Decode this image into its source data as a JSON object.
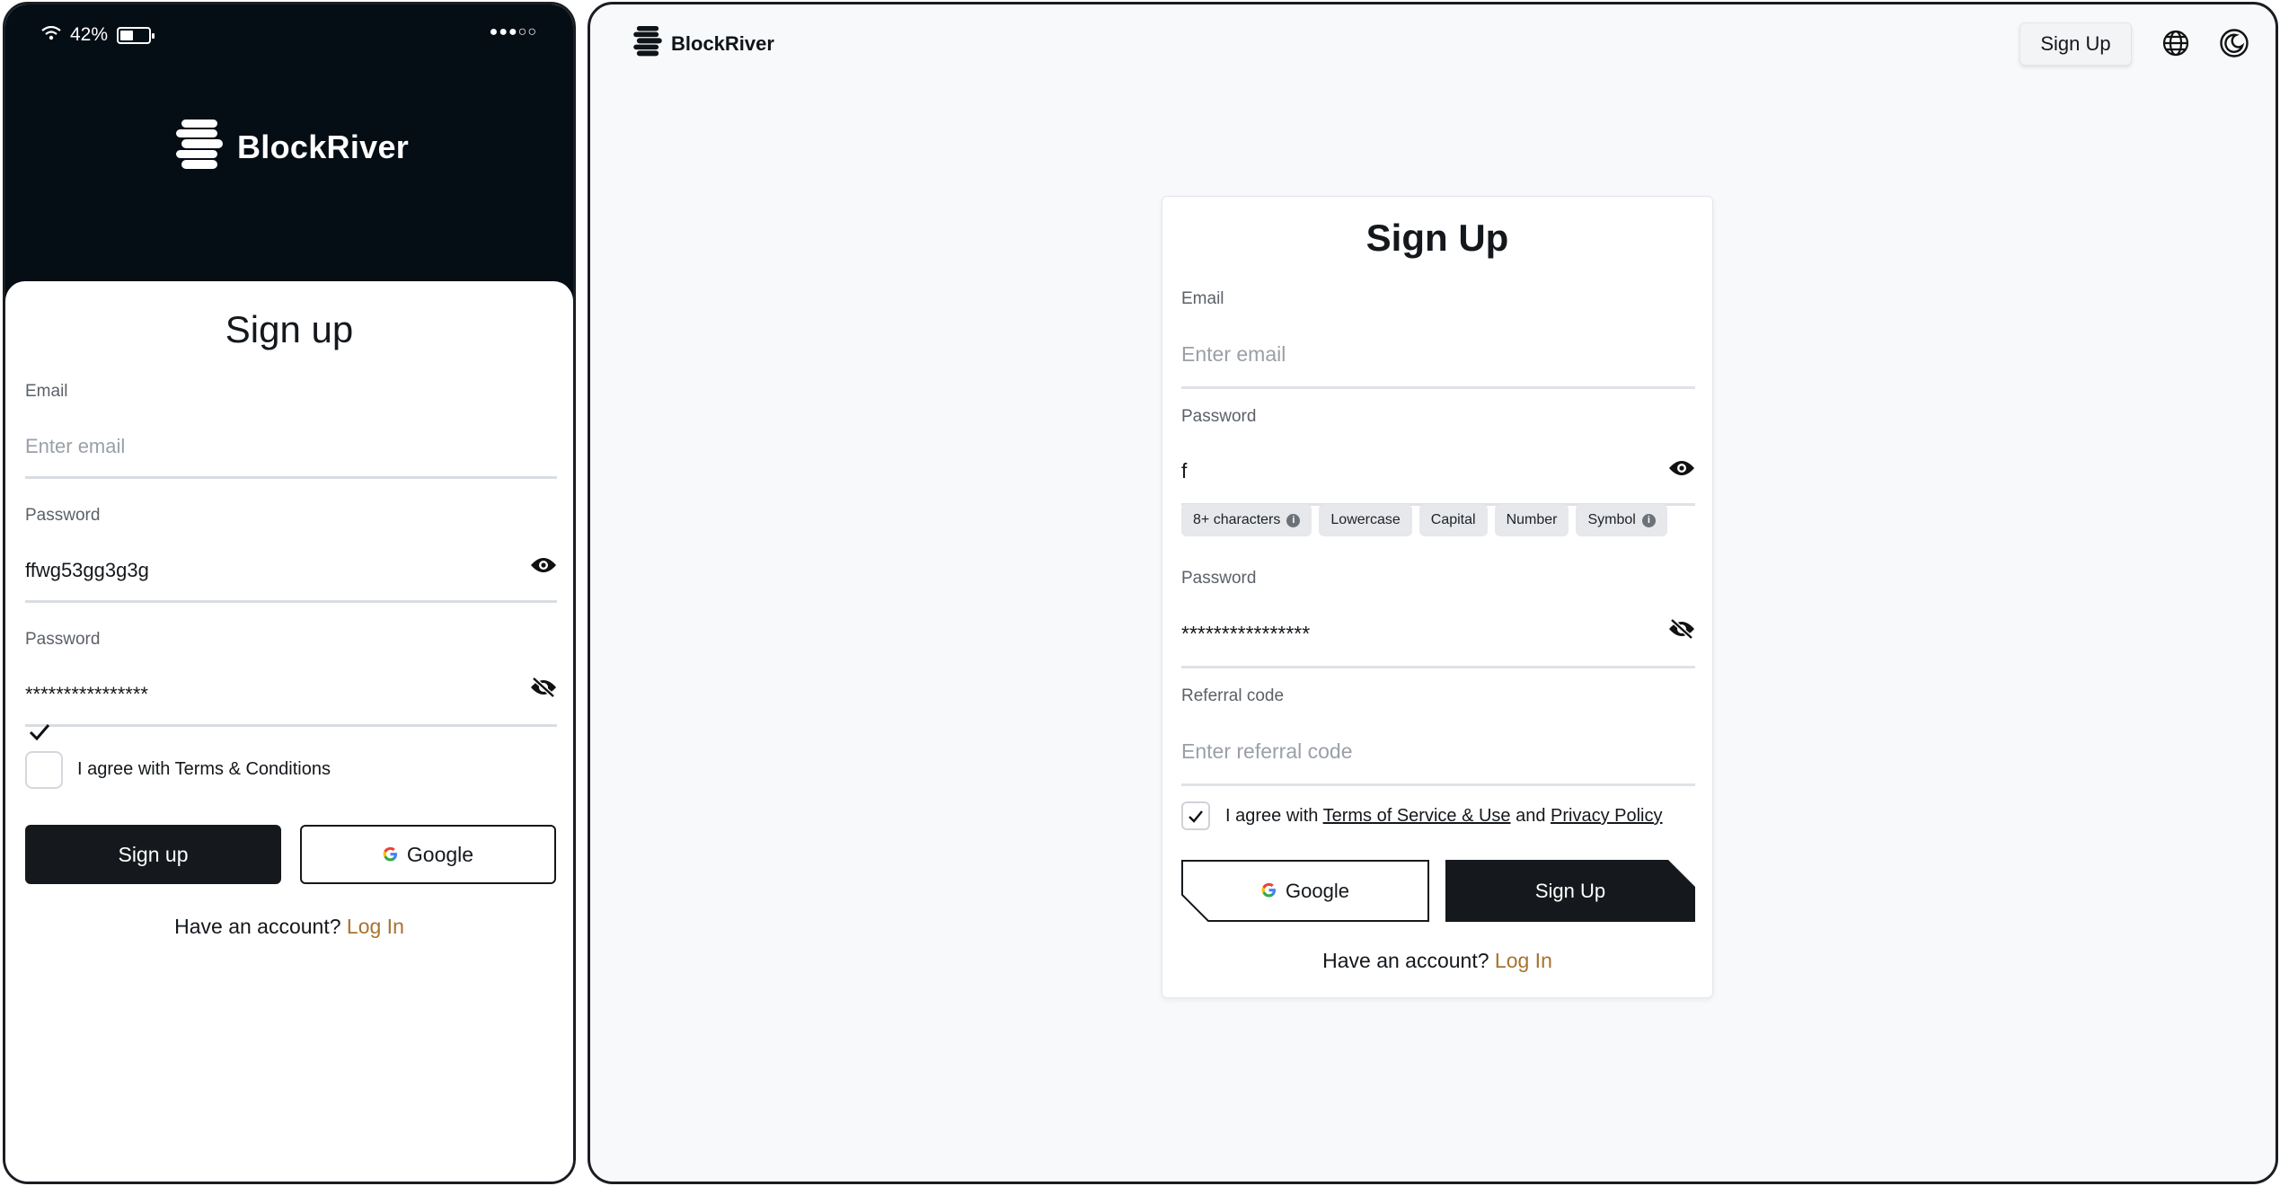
{
  "mobile": {
    "status": {
      "battery": "42%"
    },
    "brand": "BlockRiver",
    "title": "Sign up",
    "email": {
      "label": "Email",
      "placeholder": "Enter email"
    },
    "password": {
      "label": "Password",
      "value": "ffwg53gg3g3g"
    },
    "confirm_password": {
      "label": "Password",
      "value": "****************"
    },
    "terms_label": "I agree with Terms & Conditions",
    "signup_button": "Sign up",
    "google_button": "Google",
    "account_prompt": "Have an account?",
    "login_link": "Log In"
  },
  "desktop": {
    "brand": "BlockRiver",
    "header_signup": "Sign Up",
    "title": "Sign Up",
    "email": {
      "label": "Email",
      "placeholder": "Enter email"
    },
    "password": {
      "label": "Password",
      "value": "f"
    },
    "requirements": [
      "8+ characters",
      "Lowercase",
      "Capital",
      "Number",
      "Symbol"
    ],
    "confirm_password": {
      "label": "Password",
      "value": "****************"
    },
    "referral": {
      "label": "Referral code",
      "placeholder": "Enter referral code"
    },
    "terms": {
      "prefix": "I agree with ",
      "tos": "Terms of Service & Use",
      "and": " and ",
      "privacy": "Privacy Policy"
    },
    "google_button": "Google",
    "signup_button": "Sign Up",
    "account_prompt": "Have an account?",
    "login_link": "Log In"
  },
  "colors": {
    "dark": "#15191d",
    "header_bg": "#050d15",
    "link": "#a8722f",
    "page_bg": "#f8f9fa"
  }
}
